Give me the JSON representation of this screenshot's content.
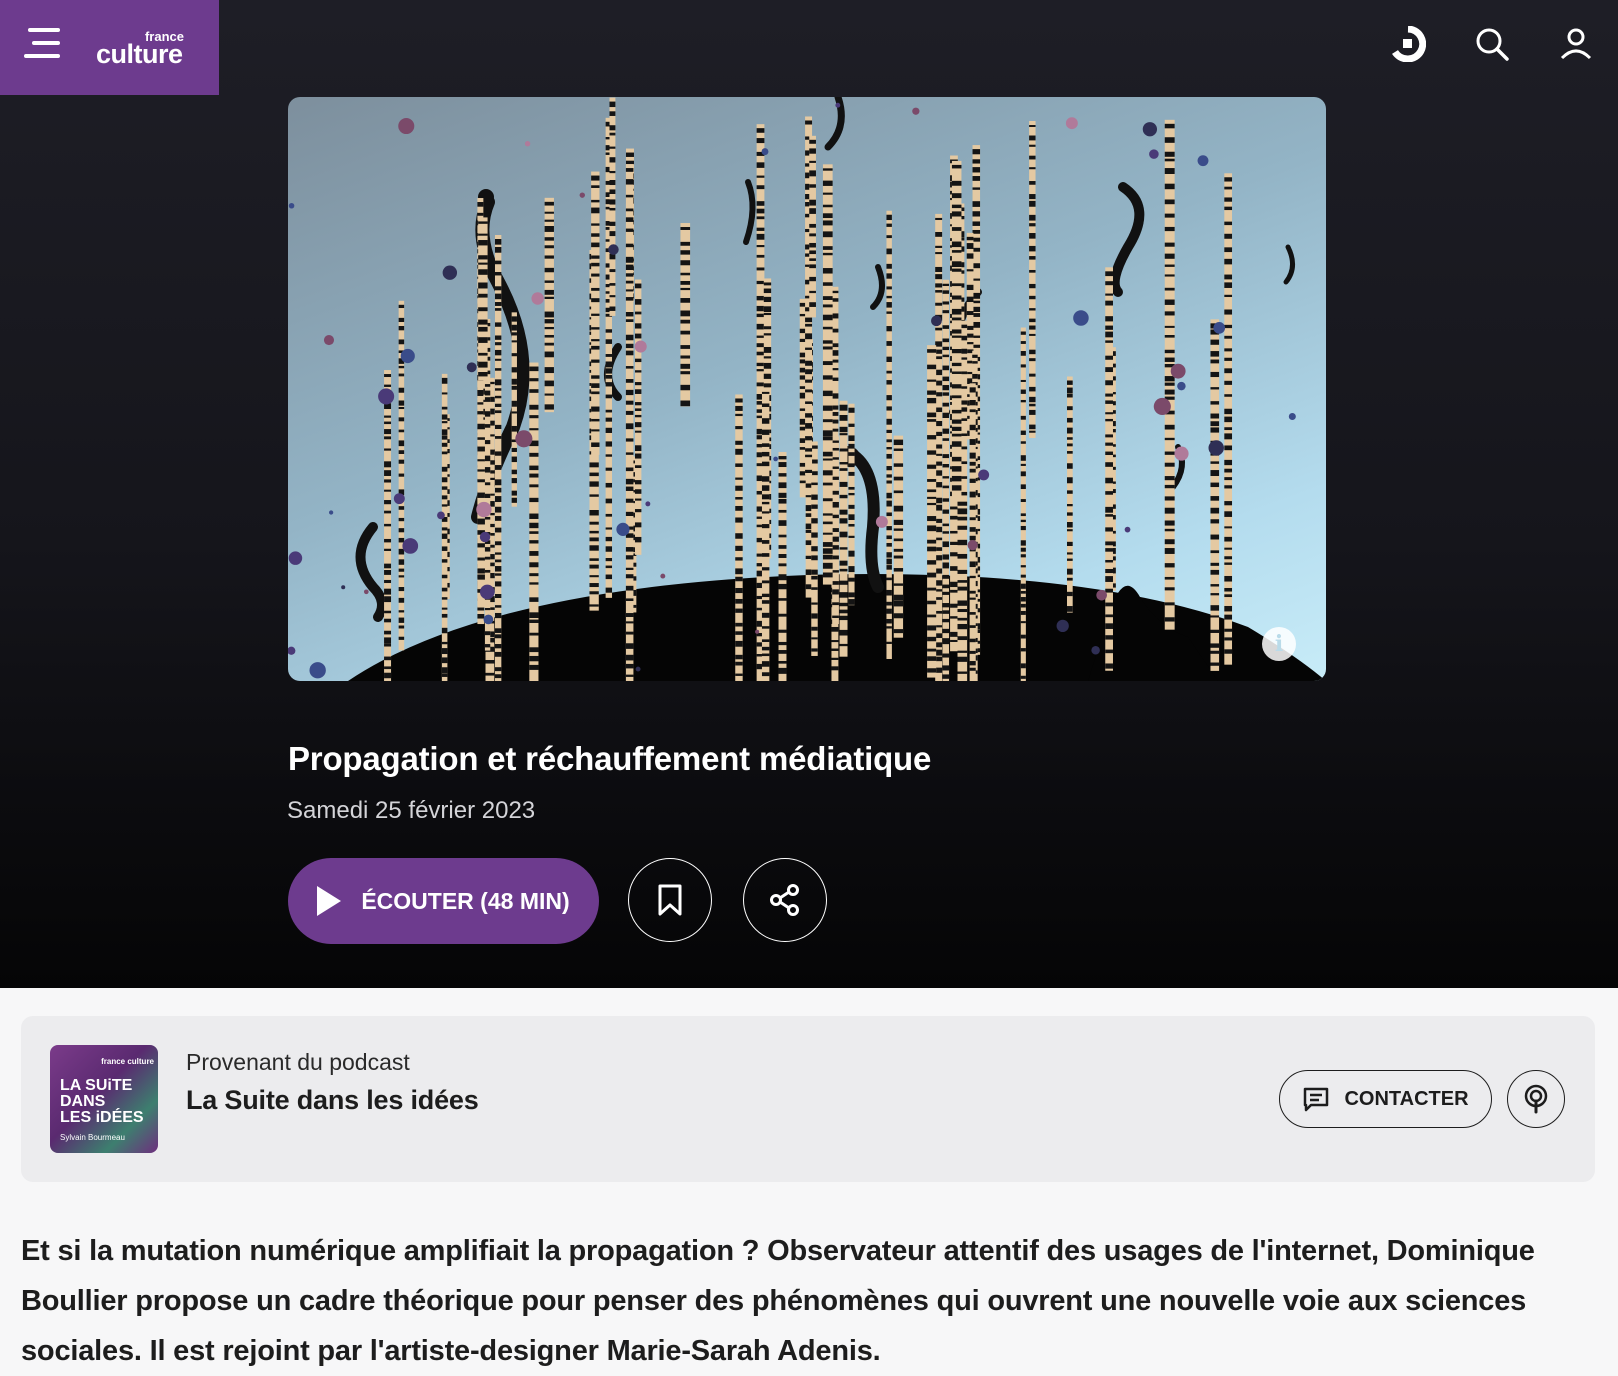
{
  "header": {
    "logo_small": "france",
    "logo_big": "culture",
    "menu_icon": "hamburger-icon",
    "right_icons": [
      "radio-live-icon",
      "search-icon",
      "user-icon"
    ]
  },
  "episode": {
    "title": "Propagation et réchauffement médiatique",
    "date": "Samedi 25 février 2023",
    "listen_label": "ÉCOUTER (48 MIN)",
    "info_glyph": "i",
    "accent_color": "#6d3b8e"
  },
  "podcast": {
    "provenance_label": "Provenant du podcast",
    "name": "La Suite dans les idées",
    "cover_logo": "france culture",
    "cover_title_lines": [
      "LA SUiTE",
      "DANS",
      "LES iDÉES"
    ],
    "cover_author": "Sylvain Bourmeau",
    "contact_label": "CONTACTER"
  },
  "description": "Et si la mutation numérique amplifiait la propagation ? Observateur attentif des usages de l'internet, Dominique Boullier propose un cadre théorique pour penser des phénomènes qui ouvrent une nouvelle voie aux sciences sociales. Il est rejoint par l'artiste-designer Marie-Sarah Adenis."
}
